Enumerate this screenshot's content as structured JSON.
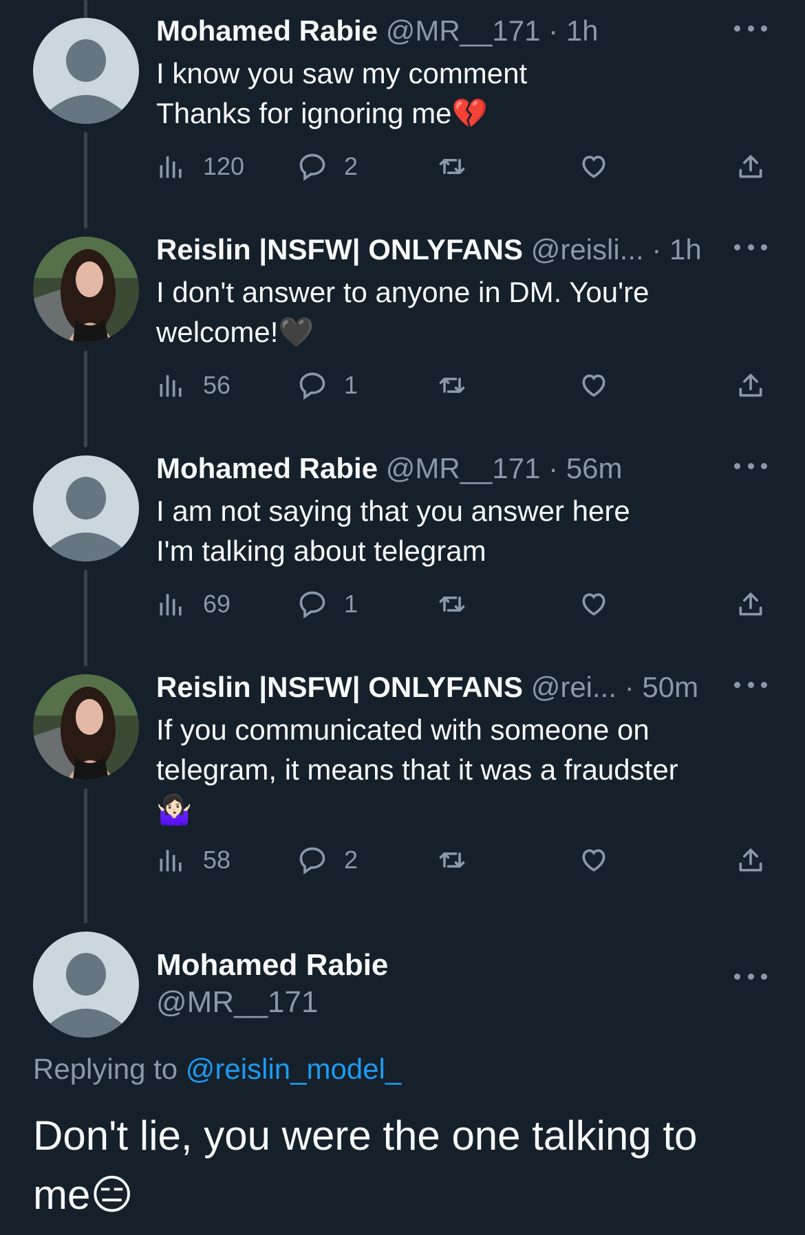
{
  "colors": {
    "background": "#15202b",
    "text_primary": "#f7f9f9",
    "text_secondary": "#8b98a5",
    "link": "#1d9bf0",
    "thread_line": "#38444d"
  },
  "tweets": [
    {
      "name": "Mohamed Rabie",
      "handle": "@MR__171",
      "time": "1h",
      "avatar": "default-avatar",
      "lines": [
        "I know you saw my comment",
        "Thanks for ignoring me💔"
      ],
      "views": "120",
      "replies": "2"
    },
    {
      "name": "Reislin |NSFW| ONLYFANS",
      "handle": "@reisli...",
      "time": "1h",
      "avatar": "photo-avatar",
      "lines": [
        "I don't answer to anyone in DM. You're",
        "welcome!🖤"
      ],
      "views": "56",
      "replies": "1"
    },
    {
      "name": "Mohamed Rabie",
      "handle": "@MR__171",
      "time": "56m",
      "avatar": "default-avatar",
      "lines": [
        "I am not saying that you answer here",
        "I'm talking about telegram"
      ],
      "views": "69",
      "replies": "1"
    },
    {
      "name": "Reislin |NSFW| ONLYFANS",
      "handle": "@rei...",
      "time": "50m",
      "avatar": "photo-avatar",
      "lines": [
        "If you communicated with someone on",
        "telegram, it means that it was a fraudster",
        "🤷🏻‍♀️"
      ],
      "views": "58",
      "replies": "2"
    }
  ],
  "reply": {
    "name": "Mohamed Rabie",
    "handle": "@MR__171",
    "replying_prefix": "Replying to",
    "replying_to": "@reislin_model_",
    "text_line1": "Don't lie, you were the one talking to",
    "text_line2": "me😑"
  },
  "icons": {
    "views": "views-chart-icon",
    "reply": "reply-bubble-icon",
    "retweet": "retweet-icon",
    "like": "heart-icon",
    "share": "share-icon",
    "more": "more-dots-icon"
  }
}
